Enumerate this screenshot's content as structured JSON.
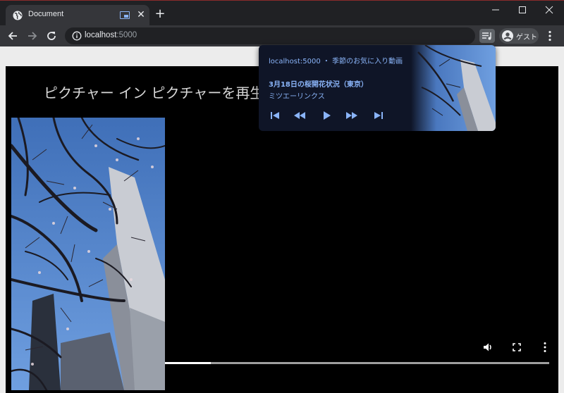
{
  "tab": {
    "title": "Document"
  },
  "omnibox": {
    "host": "localhost",
    "port": ":5000"
  },
  "profile": {
    "name": "ゲスト"
  },
  "page": {
    "heading": "ピクチャー イン ピクチャーを再生"
  },
  "video": {
    "progress_fraction": 0.12
  },
  "media_popup": {
    "source": "localhost:5000 ・ 季節のお気に入り動画",
    "title": "3月18日の桜開花状況（東京）",
    "artist": "ミツエーリンクス"
  },
  "colors": {
    "accent": "#8ab4f8",
    "popup_bg": "#0f1527",
    "toolbar": "#35363a",
    "frame": "#202124"
  }
}
